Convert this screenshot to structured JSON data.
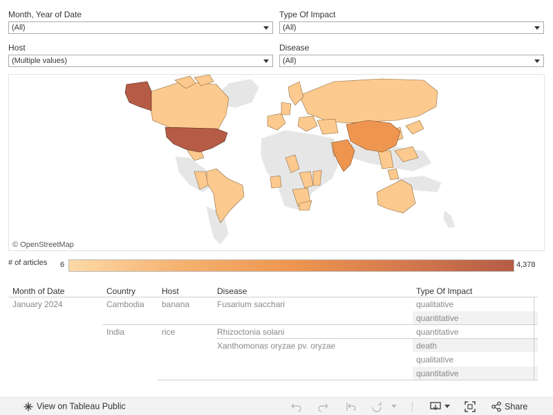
{
  "filters": {
    "month_year": {
      "label": "Month, Year of Date",
      "value": "(All)"
    },
    "type_of_impact": {
      "label": "Type Of Impact",
      "value": "(All)"
    },
    "host": {
      "label": "Host",
      "value": "(Multiple values)"
    },
    "disease": {
      "label": "Disease",
      "value": "(All)"
    }
  },
  "map": {
    "credit": "© OpenStreetMap"
  },
  "legend": {
    "title": "# of articles",
    "min": "6",
    "max": "4,378",
    "colors": [
      "#fdd9a6",
      "#f5b270",
      "#ee9650",
      "#d47a4e",
      "#b65c46"
    ]
  },
  "table": {
    "headers": [
      "Month of Date",
      "Country",
      "Host",
      "Disease",
      "Type Of Impact"
    ],
    "month": "January 2024",
    "rows": [
      {
        "country": "Cambodia",
        "host": "banana",
        "disease": "Fusarium sacchari",
        "impacts": [
          "qualitative",
          "quantitative"
        ]
      },
      {
        "country": "India",
        "host": "rice",
        "disease": "Rhizoctonia solani",
        "impacts": [
          "quantitative"
        ]
      },
      {
        "country": "",
        "host": "",
        "disease": "Xanthomonas oryzae pv. oryzae",
        "impacts": [
          "death",
          "qualitative",
          "quantitative"
        ]
      }
    ]
  },
  "footer": {
    "view_label": "View on Tableau Public",
    "share_label": "Share"
  }
}
